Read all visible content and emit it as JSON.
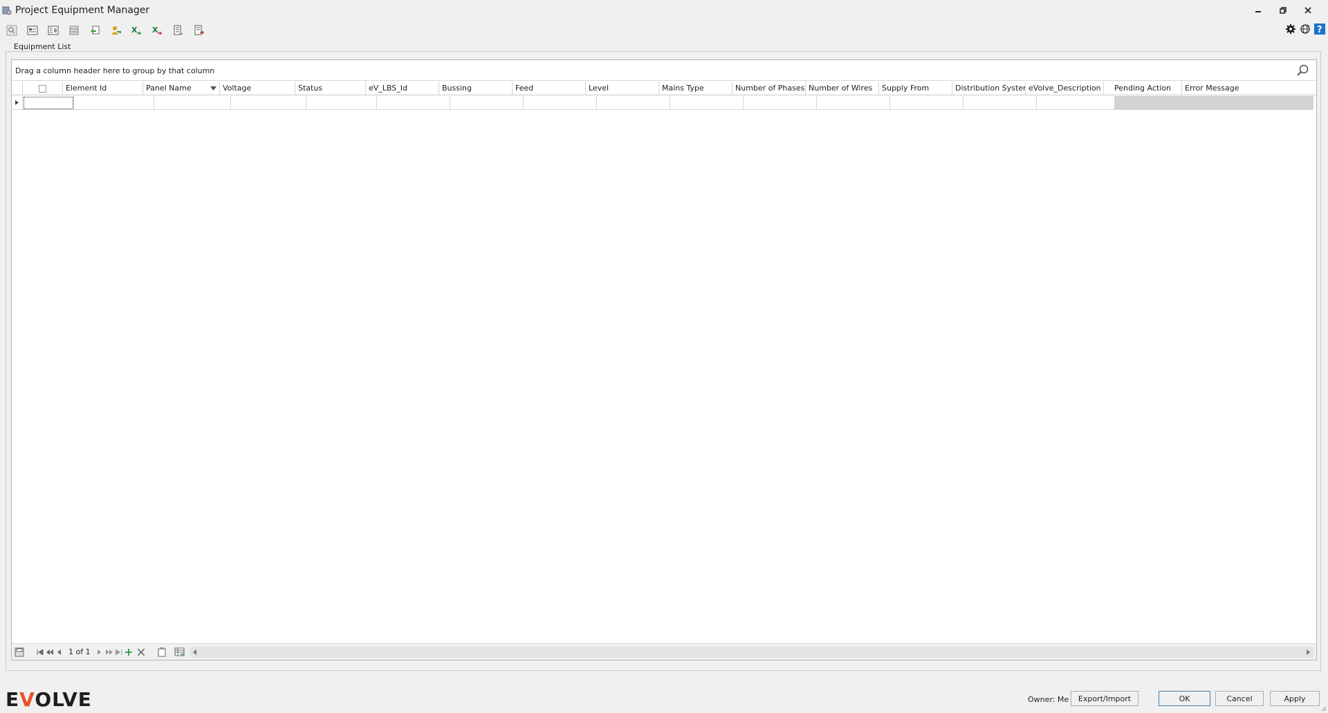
{
  "window": {
    "title": "Project Equipment Manager",
    "controls": [
      "minimize",
      "restore",
      "close"
    ]
  },
  "toolbar": {
    "buttons": [
      "search-icon",
      "form-icon",
      "form-alt-icon",
      "table-icon",
      "refresh-back-icon",
      "user-key-icon",
      "excel-import-icon",
      "excel-export-icon",
      "document-icon",
      "pdf-icon"
    ],
    "right_buttons": [
      "gear-icon",
      "globe-icon",
      "help-icon"
    ]
  },
  "group": {
    "label": "Equipment List"
  },
  "grid": {
    "group_hint": "Drag a column header here to group by that column",
    "columns": [
      "Element Id",
      "Panel Name",
      "Voltage",
      "Status",
      "eV_LBS_Id",
      "Bussing",
      "Feed",
      "Level",
      "Mains Type",
      "Number of Phases",
      "Number of Wires",
      "Supply From",
      "Distribution System",
      "eVolve_Description",
      "Pending Action",
      "Error Message"
    ]
  },
  "navigator": {
    "page_text": "1 of 1"
  },
  "footer": {
    "logo_text": "EVOLVE",
    "owner_label": "Owner: Me",
    "export_import_label": "Export/Import",
    "ok_label": "OK",
    "cancel_label": "Cancel",
    "apply_label": "Apply"
  },
  "colors": {
    "accent": "#3c7fb1",
    "logo_accent": "#e8502a",
    "readonly_cell": "#d3d3d3"
  }
}
